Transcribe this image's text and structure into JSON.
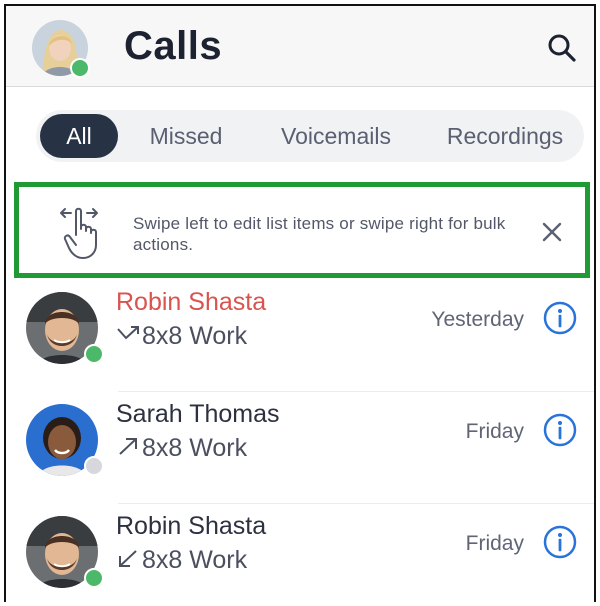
{
  "header": {
    "title": "Calls",
    "user_presence": "online",
    "search_icon": "search-icon"
  },
  "tabs": [
    {
      "label": "All",
      "active": true
    },
    {
      "label": "Missed",
      "active": false
    },
    {
      "label": "Voicemails",
      "active": false
    },
    {
      "label": "Recordings",
      "active": false
    }
  ],
  "tip": {
    "icon": "swipe-gesture-icon",
    "text": "Swipe left to edit list items or swipe right for bulk actions.",
    "close_icon": "close-icon"
  },
  "calls": [
    {
      "name": "Robin Shasta",
      "missed": true,
      "direction": "missed",
      "direction_glyph": "↘↗",
      "line": "8x8 Work",
      "when": "Yesterday",
      "presence": "online"
    },
    {
      "name": "Sarah Thomas",
      "missed": false,
      "direction": "outgoing",
      "direction_glyph": "↗",
      "line": "8x8 Work",
      "when": "Friday",
      "presence": "offline"
    },
    {
      "name": "Robin Shasta",
      "missed": false,
      "direction": "incoming",
      "direction_glyph": "↙",
      "line": "8x8 Work",
      "when": "Friday",
      "presence": "online"
    }
  ],
  "colors": {
    "accent_blue": "#2a73d9",
    "online_green": "#4cb86a",
    "offline_gray": "#d6d8de",
    "missed_red": "#d9534f",
    "highlight_green": "#1f9a35",
    "tab_active": "#283245"
  }
}
